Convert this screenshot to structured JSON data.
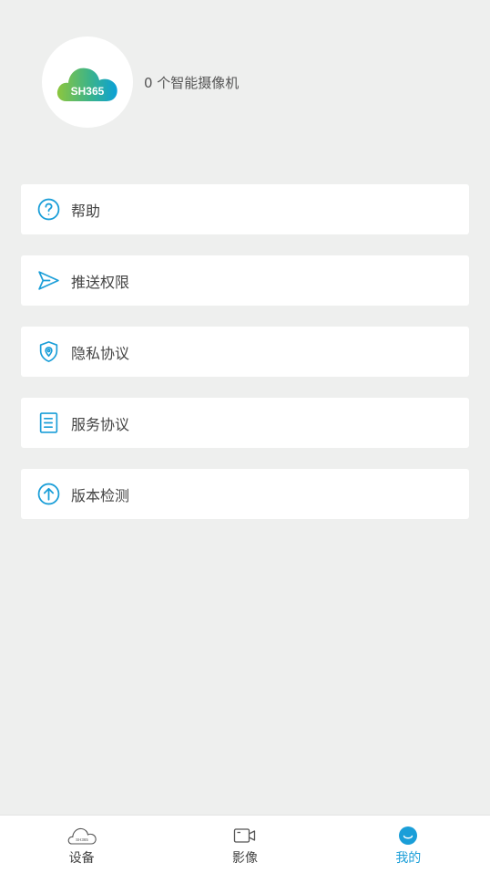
{
  "profile": {
    "logo_text": "SH365",
    "camera_count_text": "0 个智能摄像机"
  },
  "menu": {
    "items": [
      {
        "label": "帮助",
        "icon": "help-circle-icon"
      },
      {
        "label": "推送权限",
        "icon": "send-icon"
      },
      {
        "label": "隐私协议",
        "icon": "shield-location-icon"
      },
      {
        "label": "服务协议",
        "icon": "document-icon"
      },
      {
        "label": "版本检测",
        "icon": "upload-circle-icon"
      }
    ]
  },
  "tabbar": {
    "tabs": [
      {
        "label": "设备",
        "icon": "cloud-icon",
        "active": false
      },
      {
        "label": "影像",
        "icon": "video-camera-icon",
        "active": false
      },
      {
        "label": "我的",
        "icon": "smile-icon",
        "active": true
      }
    ]
  },
  "colors": {
    "accent": "#1a9ed8",
    "background": "#eeefee",
    "logo_gradient_start": "#8cc63e",
    "logo_gradient_end": "#0aa0d8"
  }
}
